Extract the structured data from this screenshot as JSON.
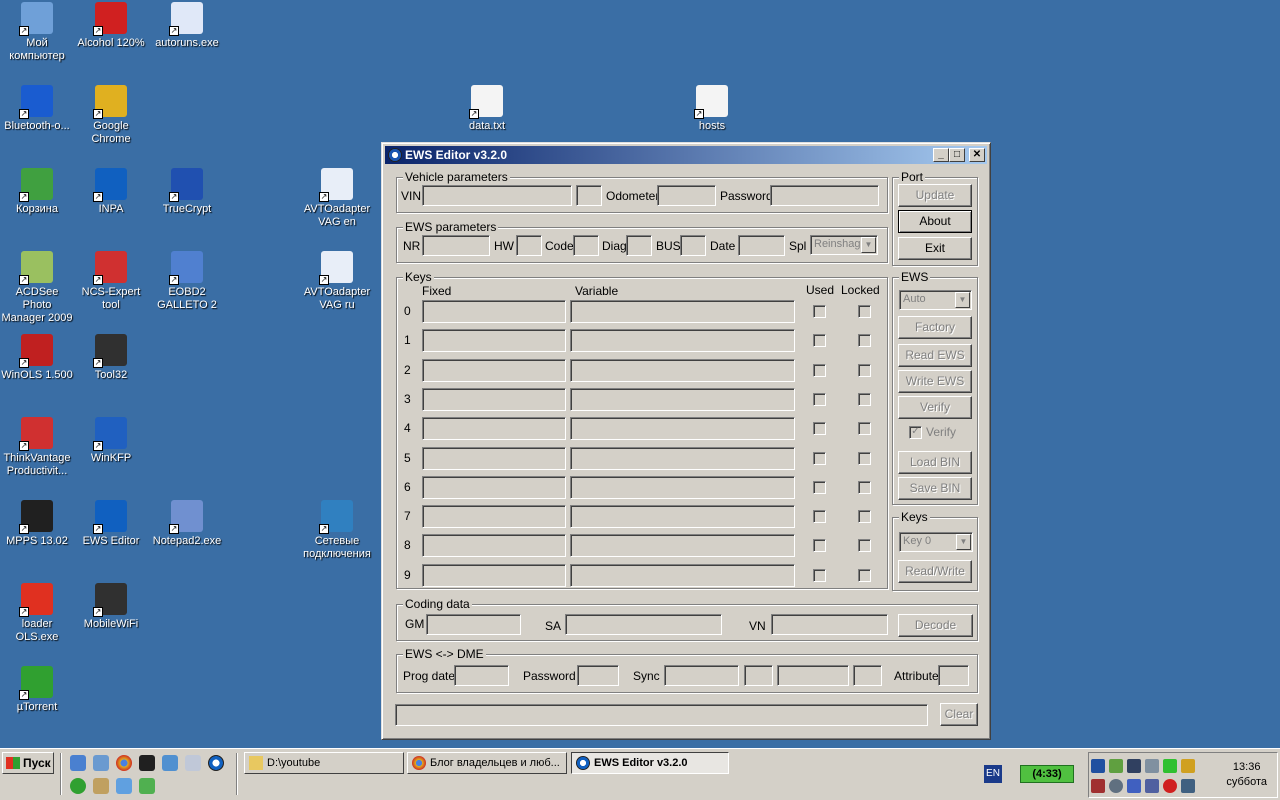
{
  "desktop": {
    "icons": [
      {
        "label": "Мой компьютер",
        "icon": "computer-icon",
        "color": "#6fa0d8"
      },
      {
        "label": "Alcohol 120%",
        "icon": "alcohol-icon",
        "color": "#d02020"
      },
      {
        "label": "autoruns.exe",
        "icon": "autoruns-icon",
        "color": "#e0e8f8"
      },
      {
        "label": "Bluetooth-о...",
        "icon": "bluetooth-icon",
        "color": "#1a5cd0"
      },
      {
        "label": "Google Chrome",
        "icon": "chrome-icon",
        "color": "#e0b020"
      },
      {
        "label": "Корзина",
        "icon": "recycle-bin-icon",
        "color": "#40a040"
      },
      {
        "label": "INPA",
        "icon": "bmw-icon",
        "color": "#1060c0"
      },
      {
        "label": "TrueCrypt",
        "icon": "truecrypt-icon",
        "color": "#2050b0"
      },
      {
        "label": "AVTOadapter VAG en",
        "icon": "vcds-icon",
        "color": "#e8eef8"
      },
      {
        "label": "ACDSee Photo Manager 2009",
        "icon": "acdsee-icon",
        "color": "#9ac060"
      },
      {
        "label": "NCS-Expert tool",
        "icon": "ncs-icon",
        "color": "#d03030"
      },
      {
        "label": "EOBD2 GALLETO 2",
        "icon": "galleto-icon",
        "color": "#5080d0"
      },
      {
        "label": "AVTOadapter VAG ru",
        "icon": "vcds-icon",
        "color": "#e8eef8"
      },
      {
        "label": "WinOLS 1.500",
        "icon": "winols-icon",
        "color": "#c02020"
      },
      {
        "label": "Tool32",
        "icon": "eye-icon",
        "color": "#303030"
      },
      {
        "label": "ThinkVantage Productivit...",
        "icon": "thinkvantage-icon",
        "color": "#d03030"
      },
      {
        "label": "WinKFP",
        "icon": "winkfp-icon",
        "color": "#2060c0"
      },
      {
        "label": "MPPS 13.02",
        "icon": "mpps-icon",
        "color": "#202020"
      },
      {
        "label": "EWS Editor",
        "icon": "bmw-icon",
        "color": "#1060c0"
      },
      {
        "label": "Notepad2.exe",
        "icon": "notepad-icon",
        "color": "#7090d0"
      },
      {
        "label": "Сетевые подключения",
        "icon": "network-icon",
        "color": "#3080c0"
      },
      {
        "label": "loader OLS.exe",
        "icon": "heart-icon",
        "color": "#e03020"
      },
      {
        "label": "MobileWiFi",
        "icon": "wifi-icon",
        "color": "#303030"
      },
      {
        "label": "µTorrent",
        "icon": "utorrent-icon",
        "color": "#30a030"
      },
      {
        "label": "data.txt",
        "icon": "text-file-icon",
        "color": "#f4f4f4"
      },
      {
        "label": "hosts",
        "icon": "hosts-file-icon",
        "color": "#f4f4f4"
      }
    ]
  },
  "window": {
    "title": "EWS Editor v3.2.0",
    "vehicle": {
      "group": "Vehicle parameters",
      "vin": "VIN",
      "odometer": "Odometer",
      "password": "Password"
    },
    "ews_params": {
      "group": "EWS parameters",
      "nr": "NR",
      "hw": "HW",
      "code": "Code",
      "diag": "Diag",
      "bus": "BUS",
      "date": "Date",
      "spl": "Spl",
      "spl_value": "Reinshag"
    },
    "port": {
      "group": "Port",
      "update": "Update",
      "about": "About",
      "exit": "Exit"
    },
    "keys": {
      "group": "Keys",
      "fixed": "Fixed",
      "variable": "Variable",
      "used": "Used",
      "locked": "Locked",
      "rows": [
        "0",
        "1",
        "2",
        "3",
        "4",
        "5",
        "6",
        "7",
        "8",
        "9"
      ]
    },
    "ews": {
      "group": "EWS",
      "mode": "Auto",
      "factory": "Factory",
      "read": "Read EWS",
      "write": "Write EWS",
      "verify_btn": "Verify",
      "verify_cb": "Verify",
      "load": "Load BIN",
      "save": "Save BIN"
    },
    "keys_panel": {
      "group": "Keys",
      "key": "Key 0",
      "rw": "Read/Write"
    },
    "coding": {
      "group": "Coding data",
      "gm": "GM",
      "sa": "SA",
      "vn": "VN",
      "decode": "Decode"
    },
    "dme": {
      "group": "EWS <-> DME",
      "prog_date": "Prog date",
      "password": "Password",
      "sync": "Sync",
      "attribute": "Attribute"
    },
    "clear": "Clear"
  },
  "taskbar": {
    "start": "Пуск",
    "tasks": [
      {
        "label": "D:\\youtube",
        "icon": "folder-icon",
        "active": false
      },
      {
        "label": "Блог владельцев и люб...",
        "icon": "chrome-icon",
        "active": false
      },
      {
        "label": "EWS Editor v3.2.0",
        "icon": "bmw-icon",
        "active": true
      }
    ],
    "lang": "EN",
    "battery": "(4:33)",
    "time": "13:36",
    "day": "суббота"
  }
}
